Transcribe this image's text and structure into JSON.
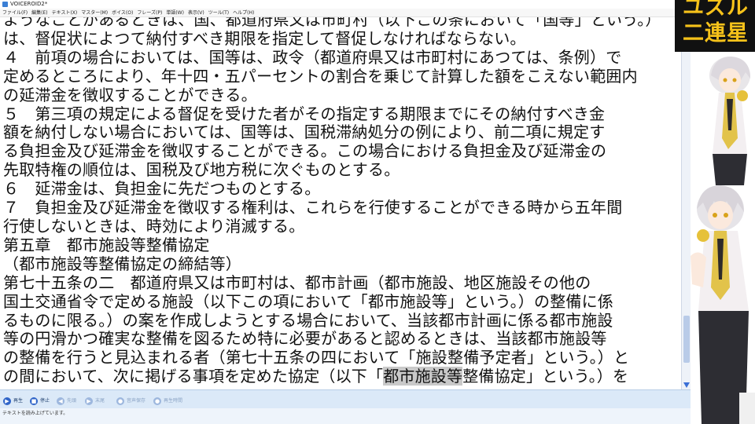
{
  "window": {
    "title": "VOICEROID2*"
  },
  "menu": [
    "ファイル(F)",
    "編集(E)",
    "テキスト(X)",
    "マスター(M)",
    "ボイス(O)",
    "フレーズ(P)",
    "単語(W)",
    "表示(V)",
    "ツール(T)",
    "ヘルプ(H)"
  ],
  "document": {
    "lines": [
      "ようなことがあるときは、国、都道府県又は市町村（以下この条において「国等」という。）",
      "は、督促状によつて納付すべき期限を指定して督促しなければならない。",
      "４　前項の場合においては、国等は、政令（都道府県又は市町村にあつては、条例）で",
      "定めるところにより、年十四・五パーセントの割合を乗じて計算した額をこえない範囲内",
      "の延滞金を徴収することができる。",
      "５　第三項の規定による督促を受けた者がその指定する期限までにその納付すべき金",
      "額を納付しない場合においては、国等は、国税滞納処分の例により、前二項に規定す",
      "る負担金及び延滞金を徴収することができる。この場合における負担金及び延滞金の",
      "先取特権の順位は、国税及び地方税に次ぐものとする。",
      "６　延滞金は、負担金に先だつものとする。",
      "７　負担金及び延滞金を徴収する権利は、これらを行使することができる時から五年間",
      "行使しないときは、時効により消滅する。",
      "第五章　都市施設等整備協定",
      "（都市施設等整備協定の締結等）",
      "第七十五条の二　都道府県又は市町村は、都市計画（都市施設、地区施設その他の",
      "国土交通省令で定める施設（以下この項において「都市施設等」という。）の整備に係",
      "るものに限る。）の案を作成しようとする場合において、当該都市計画に係る都市施設",
      "等の円滑かつ確実な整備を図るため特に必要があると認めるときは、当該都市施設等",
      "の整備を行うと見込まれる者（第七十五条の四において「施設整備予定者」という。）と"
    ],
    "last_line": {
      "before": "の間において、次に掲げる事項を定めた協定（以下「",
      "highlight": "都市施設等",
      "after": "整備協定」という。）を"
    }
  },
  "controls": [
    {
      "icon": "play-icon",
      "glyph": "▶",
      "label": "再生",
      "enabled": true
    },
    {
      "icon": "stop-icon",
      "glyph": "■",
      "label": "停止",
      "enabled": true
    },
    {
      "icon": "rewind-icon",
      "glyph": "◀",
      "label": "先頭",
      "enabled": false
    },
    {
      "icon": "forward-icon",
      "glyph": "▶",
      "label": "末尾",
      "enabled": false
    },
    {
      "icon": "save-audio-icon",
      "glyph": "●",
      "label": "音声保存",
      "enabled": false
    },
    {
      "icon": "time-icon",
      "glyph": "●",
      "label": "再生時間",
      "enabled": false
    }
  ],
  "status": {
    "text": "テキストを読み上げています。"
  },
  "logo": {
    "line1": "ユズル",
    "line2": "二連星"
  },
  "colors": {
    "accent": "#2f64c8",
    "logo_text": "#f6c21a",
    "logo_bg": "#111111",
    "highlight": "#c9c9c9"
  }
}
